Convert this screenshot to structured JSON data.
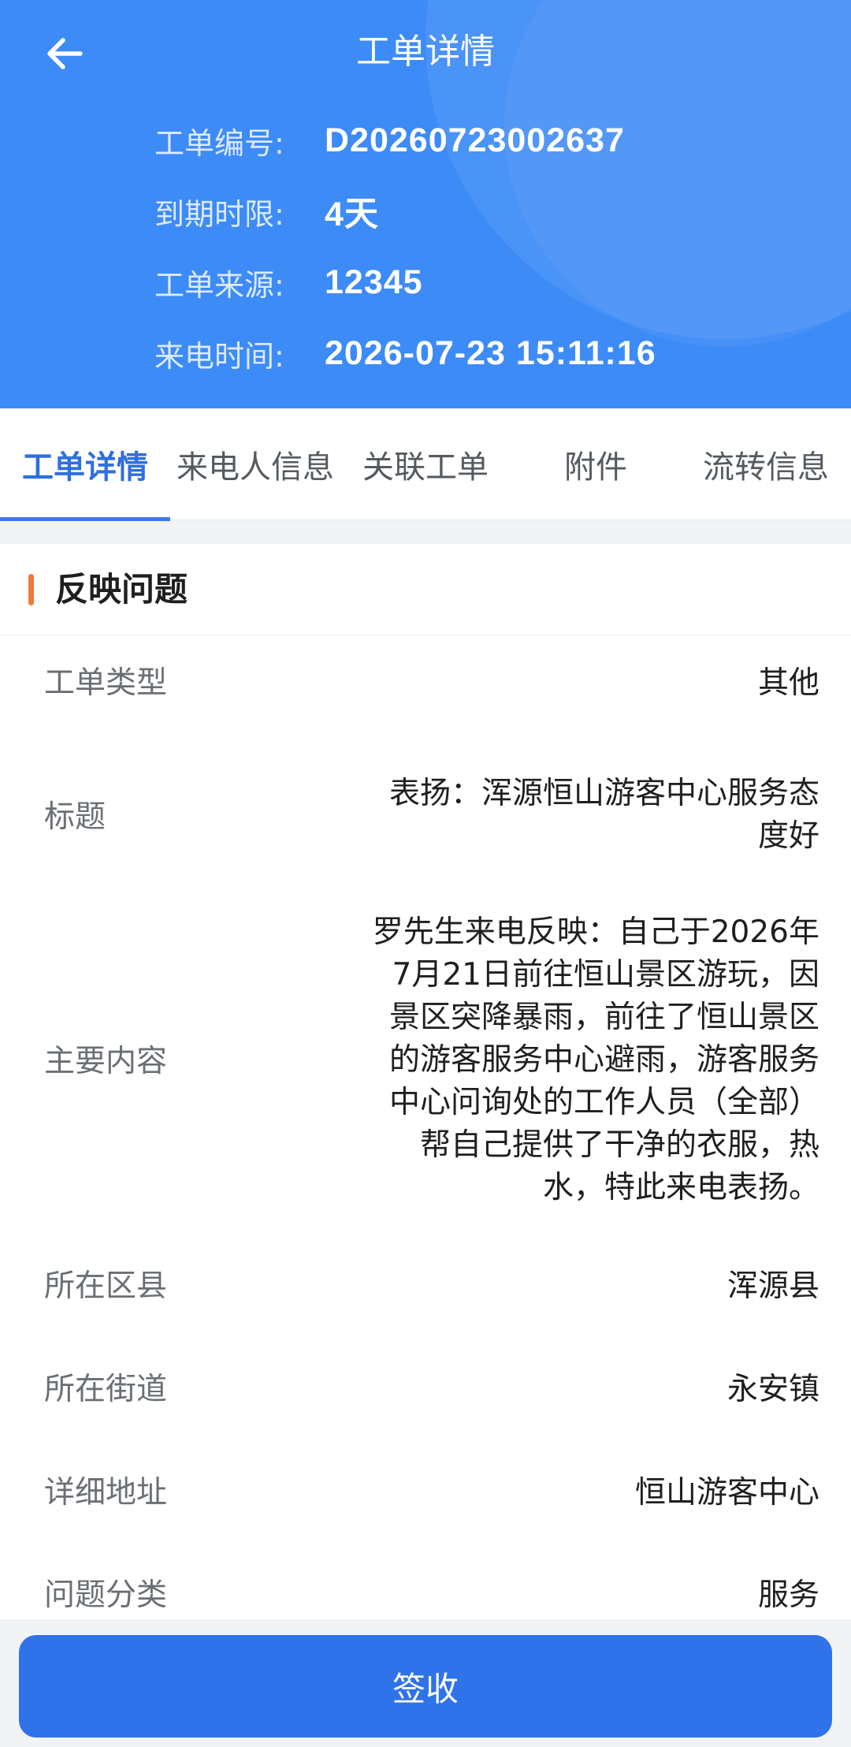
{
  "header": {
    "title": "工单详情",
    "rows": [
      {
        "label": "工单编号:",
        "value": "D20260723002637"
      },
      {
        "label": "到期时限:",
        "value": "4天"
      },
      {
        "label": "工单来源:",
        "value": "12345"
      },
      {
        "label": "来电时间:",
        "value": "2026-07-23 15:11:16"
      }
    ]
  },
  "tabs": [
    {
      "label": "工单详情",
      "active": true
    },
    {
      "label": "来电人信息"
    },
    {
      "label": "关联工单"
    },
    {
      "label": "附件"
    },
    {
      "label": "流转信息"
    }
  ],
  "section": {
    "title": "反映问题",
    "fields": [
      {
        "label": "工单类型",
        "value": "其他"
      },
      {
        "label": "标题",
        "value_lines": [
          "表扬：浑源恒山游客中心服务态",
          "度好"
        ]
      },
      {
        "label": "主要内容",
        "value_lines": [
          "罗先生来电反映：自己于2026年",
          "7月21日前往恒山景区游玩，因",
          "景区突降暴雨，前往了恒山景区",
          "的游客服务中心避雨，游客服务",
          "中心问询处的工作人员（全部）",
          "帮自己提供了干净的衣服，热",
          "水，特此来电表扬。"
        ]
      },
      {
        "label": "所在区县",
        "value": "浑源县"
      },
      {
        "label": "所在街道",
        "value": "永安镇"
      },
      {
        "label": "详细地址",
        "value": "恒山游客中心"
      },
      {
        "label": "问题分类",
        "value": "服务"
      }
    ]
  },
  "actions": {
    "sign_label": "签收"
  },
  "colors": {
    "header_bg": "#3d8bf7",
    "accent": "#2f72ea",
    "section_bar": "#f07a3a"
  },
  "icons": {
    "back": "arrow-left-icon"
  }
}
